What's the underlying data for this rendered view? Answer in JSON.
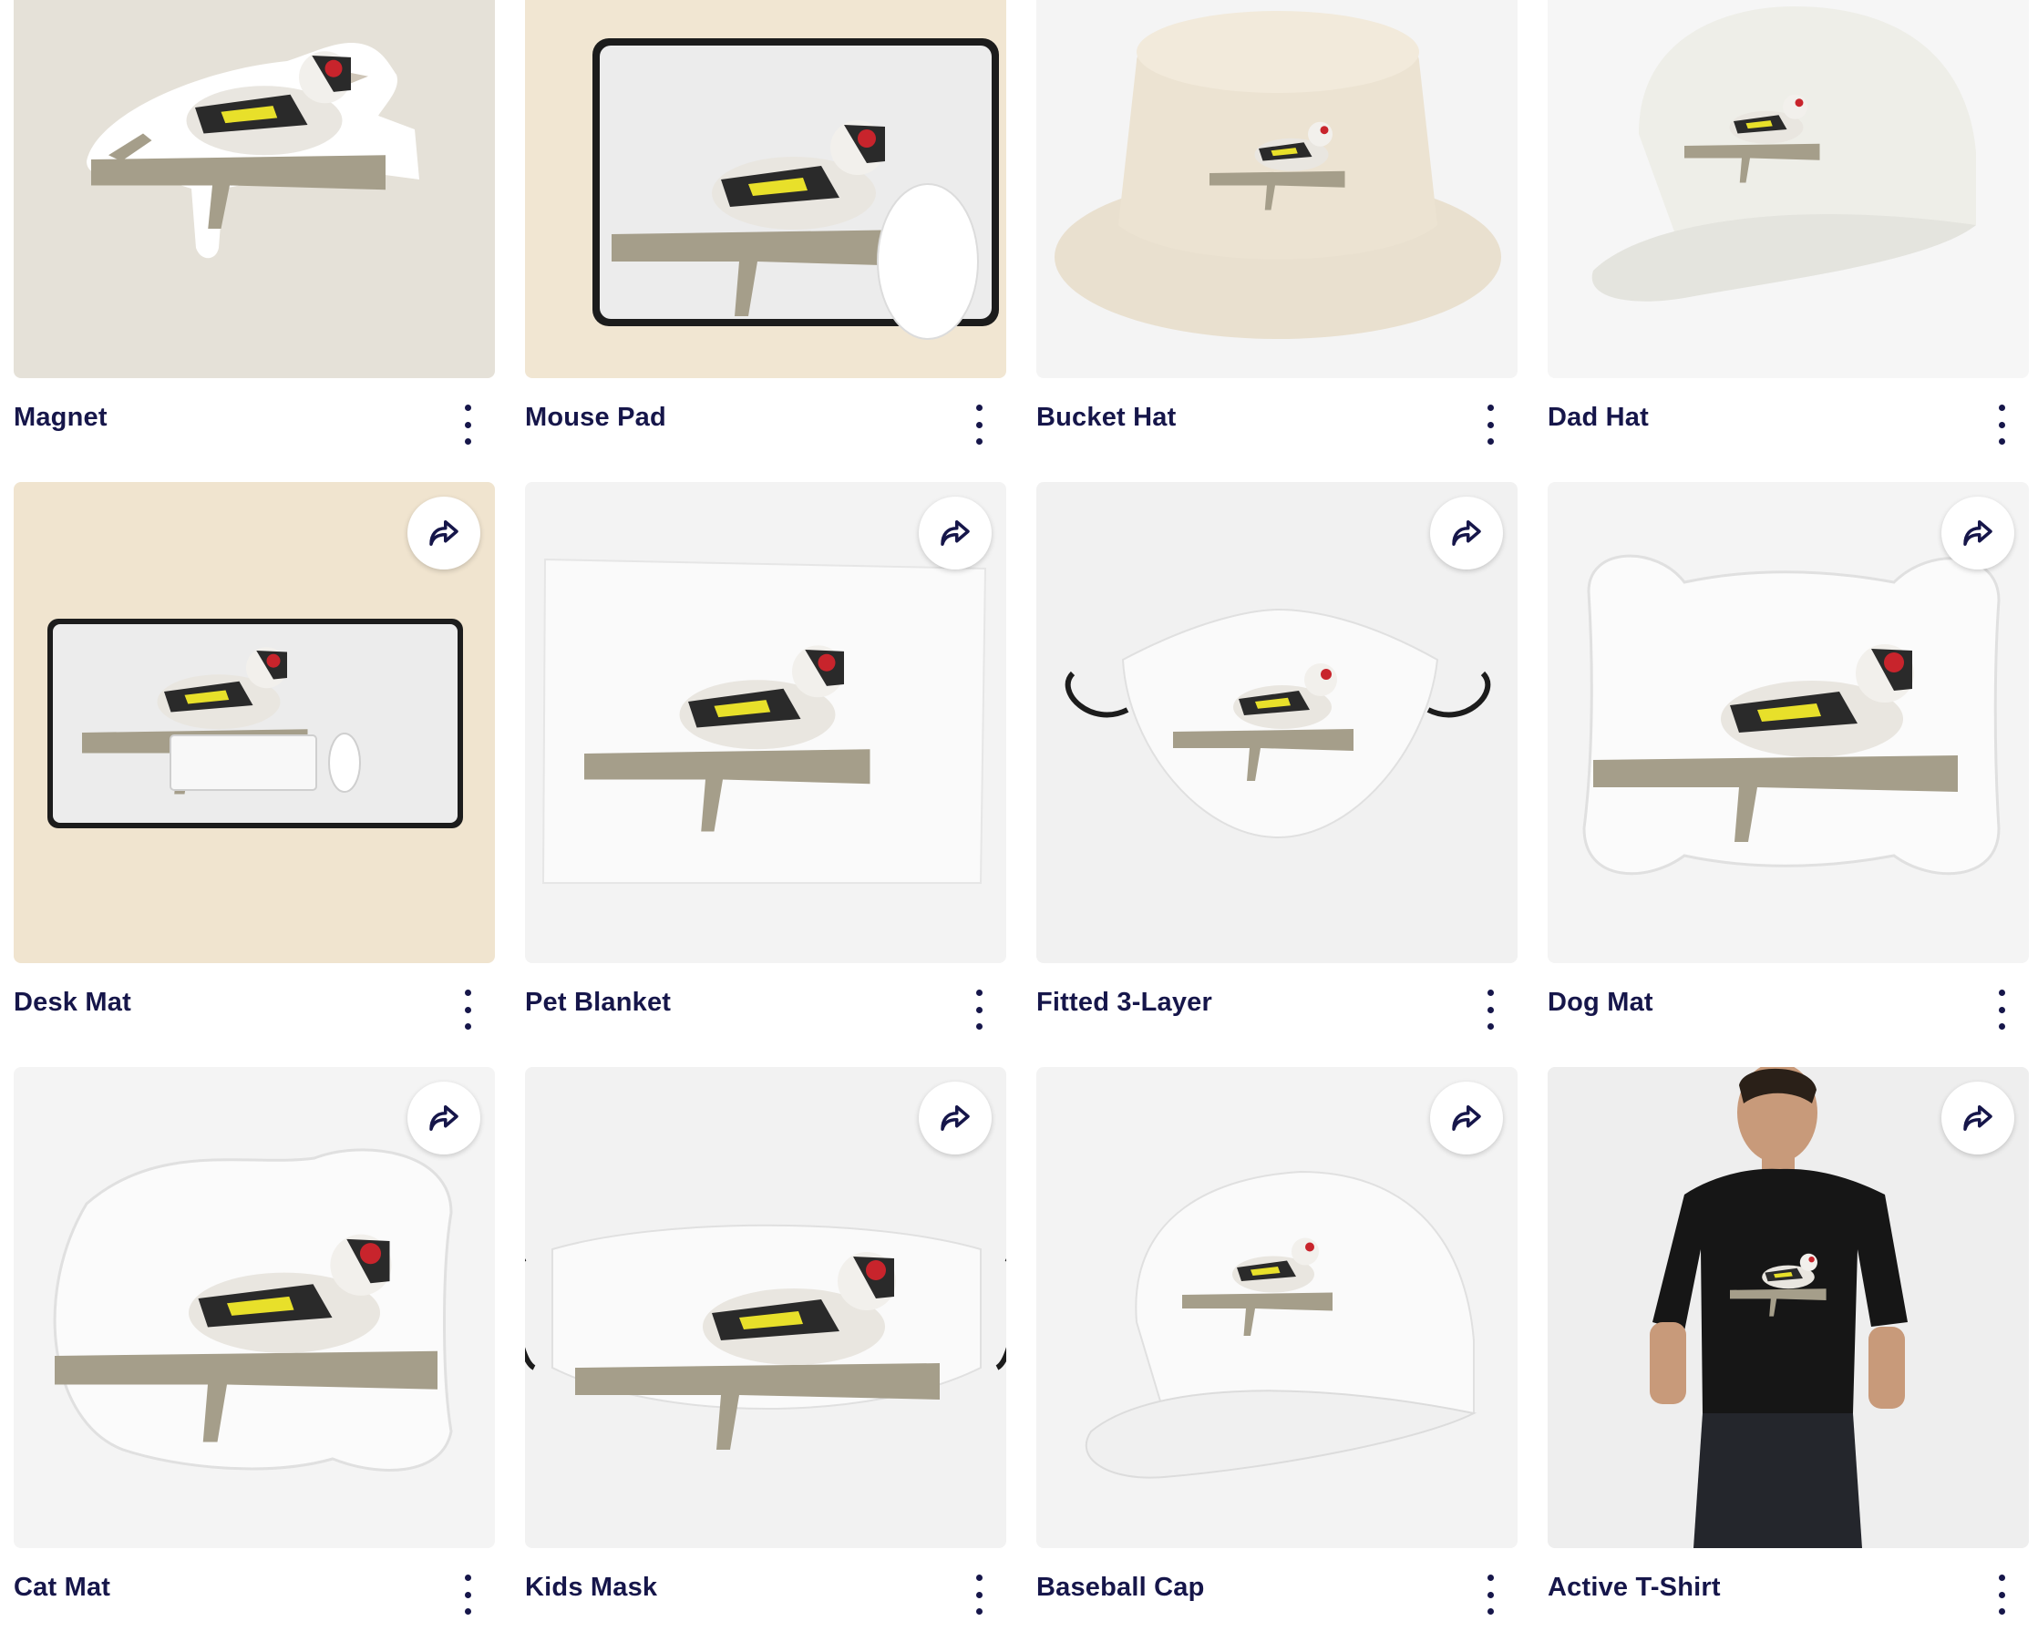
{
  "products": [
    {
      "name": "Magnet",
      "bg": "#e5e1d8"
    },
    {
      "name": "Mouse Pad",
      "bg": "#f1e6d2"
    },
    {
      "name": "Bucket Hat",
      "bg": "#f4f4f4"
    },
    {
      "name": "Dad Hat",
      "bg": "#f6f6f6"
    },
    {
      "name": "Desk Mat",
      "bg": "#f0e4cf"
    },
    {
      "name": "Pet Blanket",
      "bg": "#f3f3f3"
    },
    {
      "name": "Fitted 3-Layer",
      "bg": "#f1f1f1"
    },
    {
      "name": "Dog Mat",
      "bg": "#f4f4f4"
    },
    {
      "name": "Cat Mat",
      "bg": "#f4f4f4"
    },
    {
      "name": "Kids Mask",
      "bg": "#f2f2f2"
    },
    {
      "name": "Baseball Cap",
      "bg": "#f3f3f3"
    },
    {
      "name": "Active T-Shirt",
      "bg": "#eeeeee"
    }
  ],
  "icons": {
    "share": "share-arrow-icon",
    "more": "more-vertical-icon"
  },
  "colors": {
    "text": "#16164a",
    "bird_red": "#c8242c",
    "bird_yellow": "#e8e02a",
    "branch": "#a59e8a"
  }
}
